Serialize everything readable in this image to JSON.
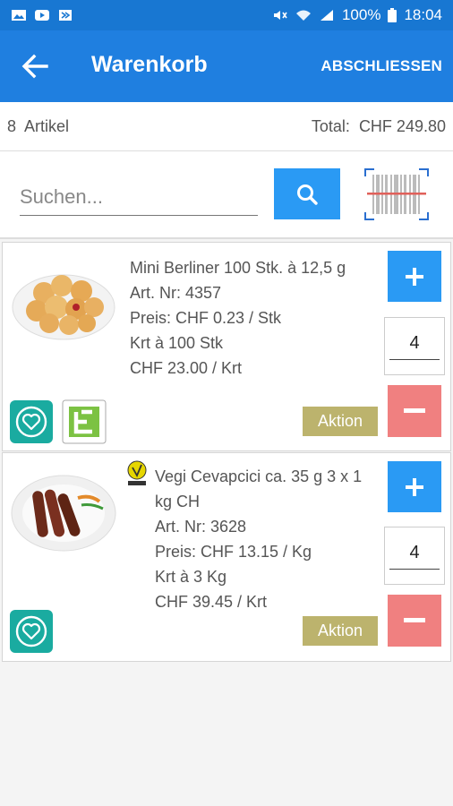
{
  "status_bar": {
    "battery": "100%",
    "time": "18:04",
    "left_icons": [
      "image-icon",
      "youtube-icon",
      "app-icon"
    ],
    "right_icons": [
      "mute-icon",
      "wifi-icon",
      "signal-icon",
      "battery-icon"
    ]
  },
  "appbar": {
    "title": "Warenkorb",
    "action_label": "ABSCHLIESSEN",
    "back_icon": "arrow-left-icon",
    "color": "#1f7fe0"
  },
  "summary": {
    "count": "8",
    "count_label": "Artikel",
    "total_label": "Total:",
    "total_value": "CHF 249.80"
  },
  "search": {
    "placeholder": "Suchen...",
    "value": ""
  },
  "items": [
    {
      "name": "Mini Berliner 100 Stk. à 12,5 g",
      "art_nr": "Art. Nr: 4357",
      "preis": "Preis: CHF 0.23  / Stk",
      "krt": "Krt à 100 Stk",
      "total": "CHF 23.00  / Krt",
      "quantity": "4",
      "aktion": "Aktion",
      "badges": [
        "heart-icon",
        "e-label-icon"
      ]
    },
    {
      "name_line1": "Vegi Cevapcici ca. 35 g 3 x 1",
      "name_line2": "kg CH",
      "art_nr": "Art. Nr: 3628",
      "preis": "Preis: CHF 13.15  / Kg",
      "krt": "Krt à 3 Kg",
      "total": "CHF 39.45  / Krt",
      "quantity": "4",
      "aktion": "Aktion",
      "badges": [
        "heart-icon",
        "vegan-icon"
      ]
    }
  ],
  "colors": {
    "primary": "#2a9af4",
    "minus": "#f08080",
    "aktion": "#bcb36d",
    "favorite": "#1aaba0"
  }
}
